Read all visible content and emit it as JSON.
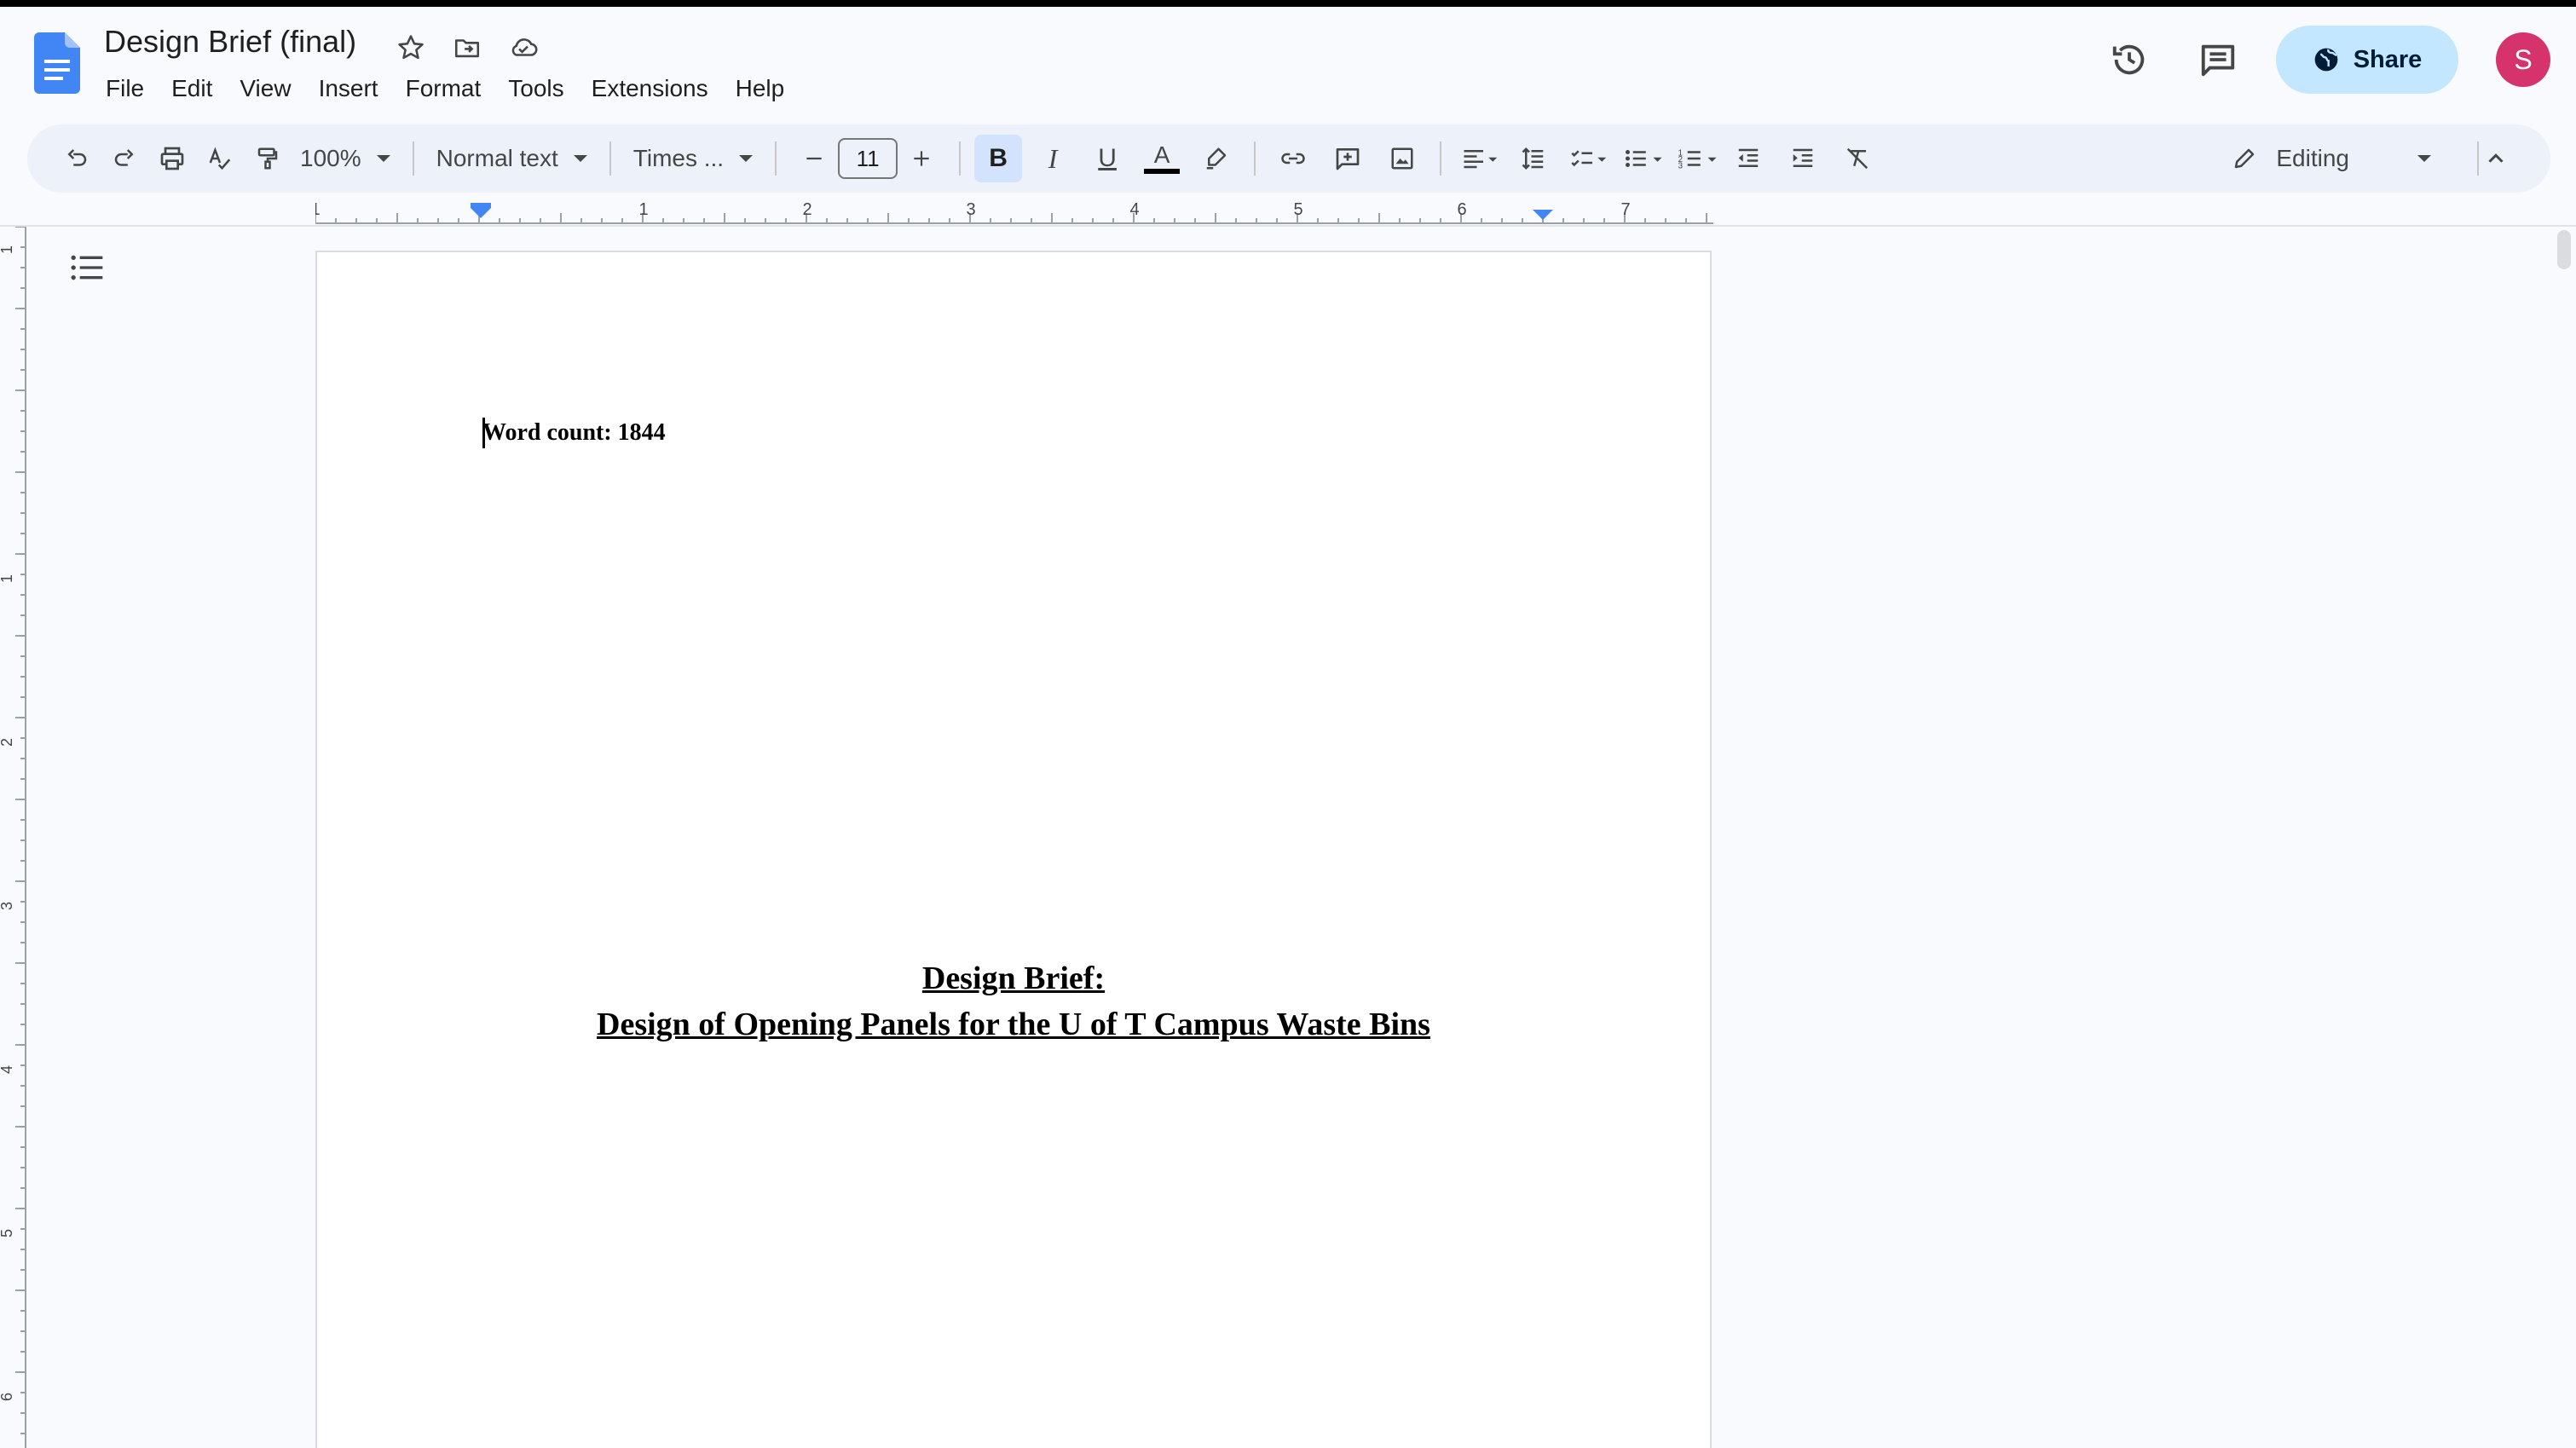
{
  "document": {
    "title": "Design Brief (final)",
    "word_count_line": "Word count: 1844",
    "heading_line1": "Design Brief:",
    "heading_line2": "Design of Opening Panels for the U of T Campus Waste Bins"
  },
  "menu": [
    "File",
    "Edit",
    "View",
    "Insert",
    "Format",
    "Tools",
    "Extensions",
    "Help"
  ],
  "header": {
    "share_label": "Share",
    "avatar_initial": "S"
  },
  "toolbar": {
    "zoom": "100%",
    "style": "Normal text",
    "font": "Times ...",
    "font_size": "11",
    "bold": "B",
    "italic": "I",
    "underline": "U",
    "text_color_letter": "A",
    "mode": "Editing"
  },
  "ruler": {
    "h_labels": [
      "1",
      "1",
      "2",
      "3",
      "4",
      "5",
      "6",
      "7"
    ],
    "v_labels": [
      "1",
      "1",
      "2",
      "3",
      "4",
      "5",
      "6"
    ]
  },
  "colors": {
    "accent": "#1a73e8",
    "share_bg": "#c2e7ff",
    "avatar_bg": "#d6336c",
    "toolbar_bg": "#edf2fa"
  }
}
